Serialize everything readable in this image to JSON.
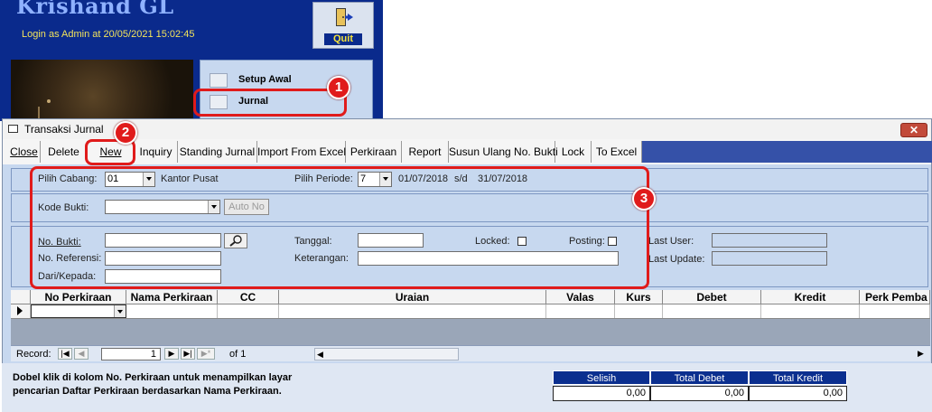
{
  "app": {
    "title": "Krishand GL",
    "login_text": "Login as Admin at 20/05/2021 15:02:45",
    "quit_label": "Quit",
    "menu": [
      {
        "label": "Setup Awal"
      },
      {
        "label": "Jurnal"
      }
    ]
  },
  "callouts": [
    "1",
    "2",
    "3"
  ],
  "window": {
    "title": "Transaksi Jurnal",
    "close_glyph": "✕",
    "toolbar": [
      "Close",
      "Delete",
      "New",
      "Inquiry",
      "Standing Jurnal",
      "Import From Excel",
      "Perkiraan",
      "Report",
      "Susun Ulang No. Bukti",
      "Lock",
      "To Excel"
    ]
  },
  "filters": {
    "cabang_label": "Pilih Cabang:",
    "cabang_value": "01",
    "cabang_name": "Kantor Pusat",
    "periode_label": "Pilih Periode:",
    "periode_value": "7",
    "periode_start": "01/07/2018",
    "periode_sep": "s/d",
    "periode_end": "31/07/2018",
    "kode_bukti_label": "Kode Bukti:",
    "kode_bukti_value": "",
    "auto_no_label": "Auto No"
  },
  "form": {
    "no_bukti_label": "No. Bukti:",
    "no_referensi_label": "No. Referensi:",
    "dari_kepada_label": "Dari/Kepada:",
    "tanggal_label": "Tanggal:",
    "keterangan_label": "Keterangan:",
    "locked_label": "Locked:",
    "posting_label": "Posting:",
    "last_user_label": "Last User:",
    "last_update_label": "Last Update:"
  },
  "grid": {
    "columns": [
      "No Perkiraan",
      "Nama Perkiraan",
      "CC",
      "Uraian",
      "Valas",
      "Kurs",
      "Debet",
      "Kredit",
      "Perk Pemba"
    ]
  },
  "nav": {
    "record_label": "Record:",
    "current": "1",
    "of_text": "of 1"
  },
  "footer": {
    "help_text": "Dobel klik di kolom No. Perkiraan untuk menampilkan layar pencarian Daftar Perkiraan berdasarkan Nama Perkiraan.",
    "totals_headers": [
      "Selisih",
      "Total Debet",
      "Total Kredit"
    ],
    "totals_values": [
      "0,00",
      "0,00",
      "0,00"
    ]
  }
}
